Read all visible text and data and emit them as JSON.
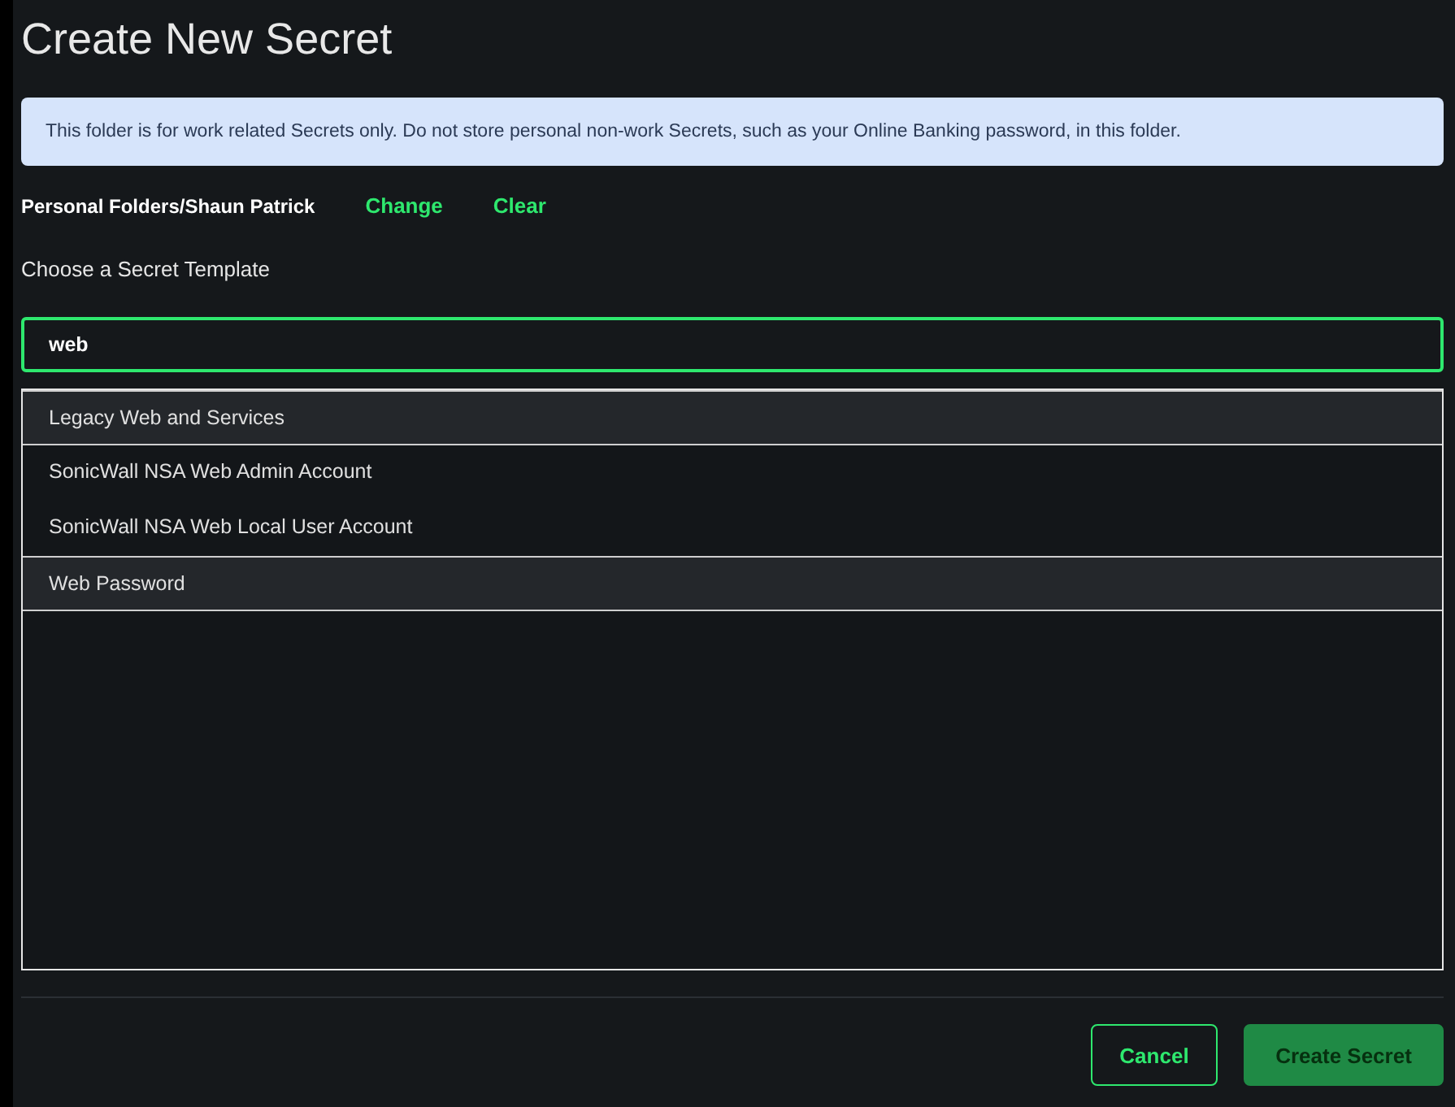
{
  "dialog": {
    "title": "Create New Secret"
  },
  "alert": "This folder is for work related Secrets only. Do not store personal non-work Secrets, such as your Online Banking password, in this folder.",
  "folder": {
    "path": "Personal Folders/Shaun Patrick",
    "actions": [
      "Change",
      "Clear"
    ]
  },
  "template_label": "Choose a Secret Template",
  "search": {
    "value": "web",
    "focused": true
  },
  "results": [
    {
      "label": "Legacy Web and Services",
      "highlighted": true
    },
    {
      "label": "SonicWall NSA Web Admin Account",
      "highlighted": false
    },
    {
      "label": "SonicWall NSA Web Local User Account",
      "highlighted": false
    },
    {
      "label": "Web Password",
      "highlighted": true
    }
  ],
  "buttons": [
    {
      "label": "Cancel",
      "kind": "secondary",
      "disabled": false
    },
    {
      "label": "Create Secret",
      "kind": "primary",
      "disabled": true
    }
  ]
}
